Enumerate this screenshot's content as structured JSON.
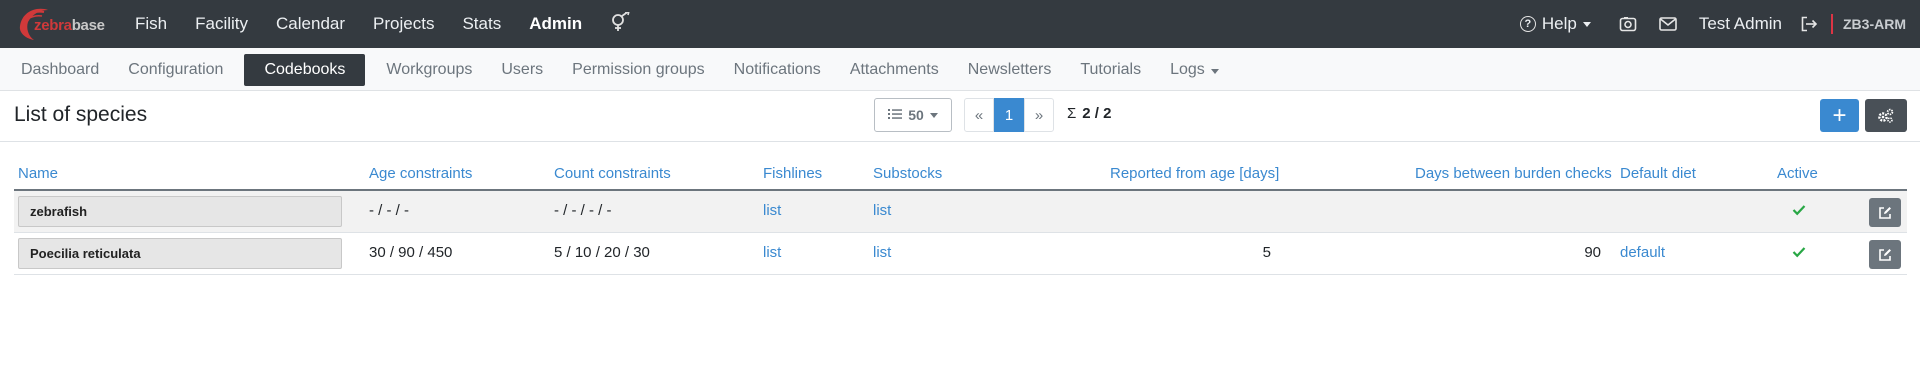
{
  "brand": {
    "logo_part1": "zebra",
    "logo_part2": "base"
  },
  "topnav": {
    "items": [
      {
        "label": "Fish"
      },
      {
        "label": "Facility"
      },
      {
        "label": "Calendar"
      },
      {
        "label": "Projects"
      },
      {
        "label": "Stats"
      },
      {
        "label": "Admin"
      }
    ],
    "active": "Admin",
    "help_label": "Help",
    "user_name": "Test Admin",
    "org_code": "ZB3-ARM"
  },
  "subnav": {
    "items": [
      {
        "label": "Dashboard"
      },
      {
        "label": "Configuration"
      },
      {
        "label": "Codebooks"
      },
      {
        "label": "Workgroups"
      },
      {
        "label": "Users"
      },
      {
        "label": "Permission groups"
      },
      {
        "label": "Notifications"
      },
      {
        "label": "Attachments"
      },
      {
        "label": "Newsletters"
      },
      {
        "label": "Tutorials"
      },
      {
        "label": "Logs"
      }
    ],
    "active": "Codebooks"
  },
  "page": {
    "title": "List of species",
    "per_page": "50",
    "pagination": {
      "prev": "«",
      "current": "1",
      "next": "»"
    },
    "count_symbol": "Σ",
    "count": "2 / 2",
    "add_label": "+"
  },
  "table": {
    "columns": {
      "name": "Name",
      "age": "Age constraints",
      "count": "Count constraints",
      "fishlines": "Fishlines",
      "substocks": "Substocks",
      "reported": "Reported from age [days]",
      "burden": "Days between burden checks",
      "diet": "Default diet",
      "active": "Active"
    },
    "rows": [
      {
        "name": "zebrafish",
        "age": "- / - / -",
        "count": "- / - / - / -",
        "fishlines": "list",
        "substocks": "list",
        "reported": "",
        "burden": "",
        "diet": "",
        "active": true
      },
      {
        "name": "Poecilia reticulata",
        "age": "30 / 90 / 450",
        "count": "5 / 10 / 20 / 30",
        "fishlines": "list",
        "substocks": "list",
        "reported": "5",
        "burden": "90",
        "diet": "default",
        "active": true
      }
    ]
  },
  "colors": {
    "navbar_bg": "#343a40",
    "accent": "#3a89d0",
    "brand_red": "#d0393a",
    "active_check": "#28a745"
  }
}
